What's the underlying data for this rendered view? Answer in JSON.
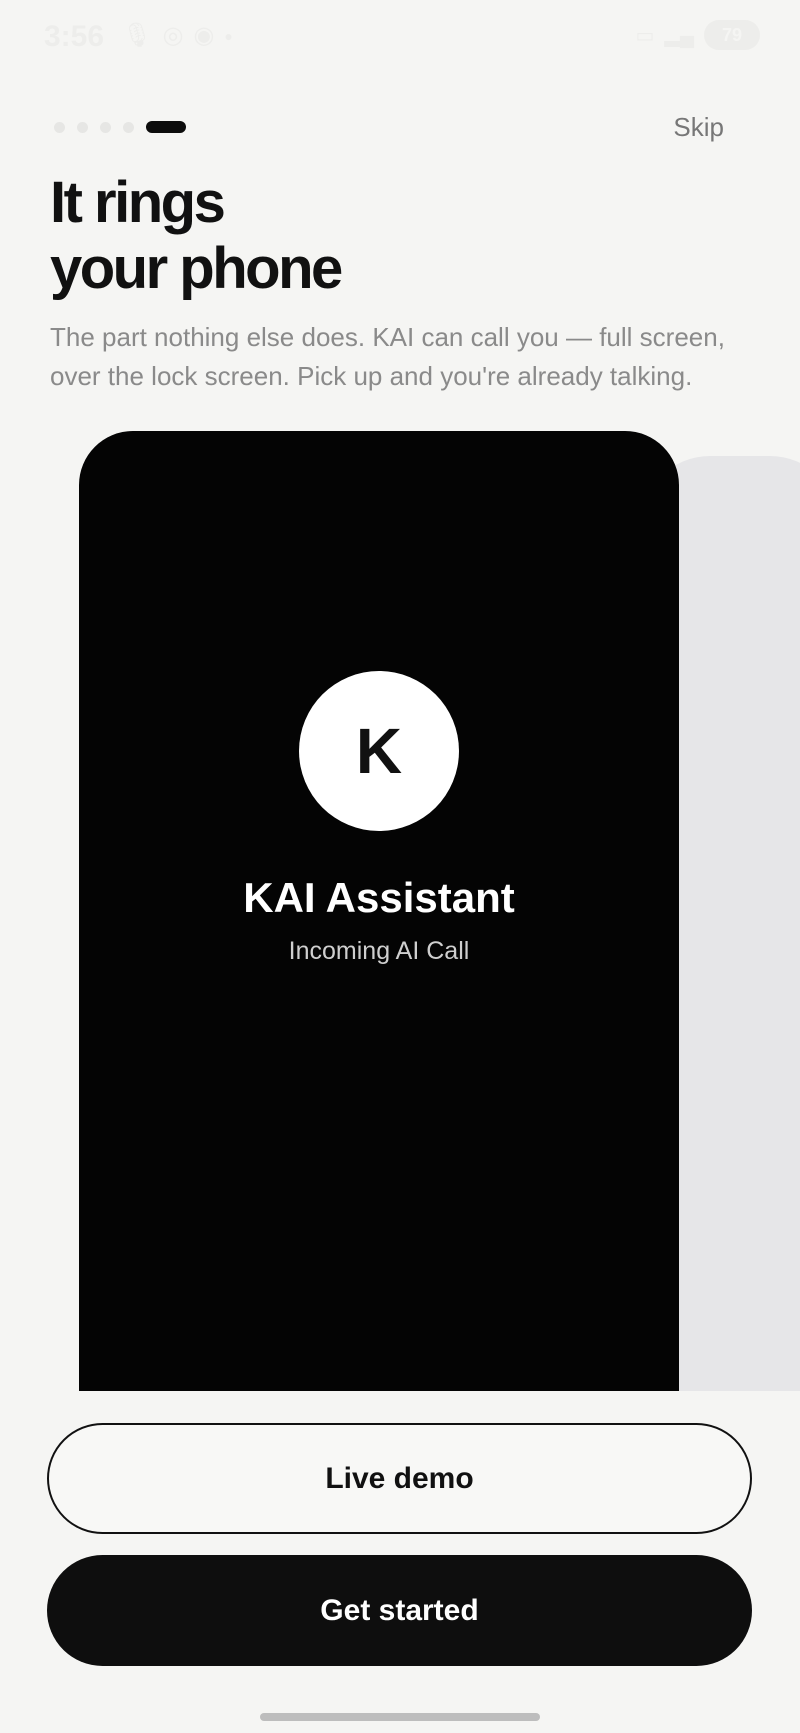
{
  "status_bar": {
    "time": "3:56",
    "battery": "79",
    "icons_left": [
      "mic-icon",
      "instagram-icon",
      "snapchat-icon",
      "dot-icon"
    ],
    "icons_right": [
      "sim-icon",
      "signal-icon",
      "battery-icon"
    ]
  },
  "onboarding": {
    "total_steps": 5,
    "current_step": 5,
    "skip_label": "Skip",
    "title_line1": "It rings",
    "title_line2": "your phone",
    "description": "The part nothing else does. KAI can call you — full screen, over the lock screen. Pick up and you're already talking."
  },
  "call_preview": {
    "avatar_letter": "K",
    "caller_name": "KAI Assistant",
    "status": "Incoming AI Call"
  },
  "actions": {
    "live_demo_label": "Live demo",
    "get_started_label": "Get started"
  },
  "colors": {
    "background": "#f5f5f3",
    "primary": "#0e0e0e",
    "card": "#040404",
    "muted_text": "#8a8a8a"
  }
}
